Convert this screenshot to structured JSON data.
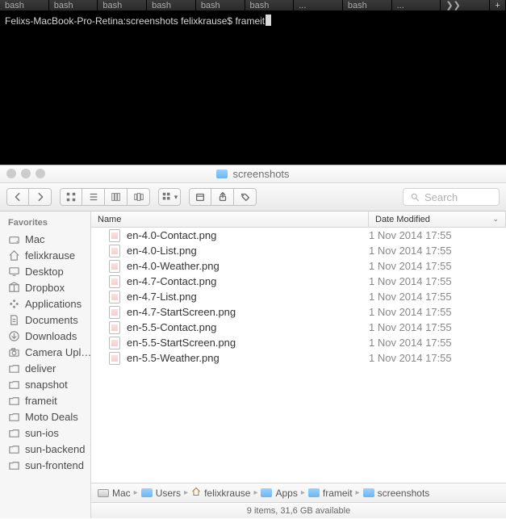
{
  "terminal": {
    "tabs": [
      "bash",
      "bash",
      "bash",
      "bash",
      "bash",
      "bash",
      "...",
      "bash",
      "...",
      "❯❯"
    ],
    "add": "+",
    "prompt": "Felixs-MacBook-Pro-Retina:screenshots felixkrause$ ",
    "command": "frameit"
  },
  "finder": {
    "window_title": "screenshots",
    "toolbar": {
      "search_placeholder": "Search"
    },
    "sidebar": {
      "heading": "Favorites",
      "items": [
        {
          "icon": "disk",
          "label": "Mac"
        },
        {
          "icon": "home",
          "label": "felixkrause"
        },
        {
          "icon": "desktop",
          "label": "Desktop"
        },
        {
          "icon": "box",
          "label": "Dropbox"
        },
        {
          "icon": "apps",
          "label": "Applications"
        },
        {
          "icon": "doc",
          "label": "Documents"
        },
        {
          "icon": "download",
          "label": "Downloads"
        },
        {
          "icon": "camera",
          "label": "Camera Upl…"
        },
        {
          "icon": "folder",
          "label": "deliver"
        },
        {
          "icon": "folder",
          "label": "snapshot"
        },
        {
          "icon": "folder",
          "label": "frameit"
        },
        {
          "icon": "folder",
          "label": "Moto Deals"
        },
        {
          "icon": "folder",
          "label": "sun-ios"
        },
        {
          "icon": "folder",
          "label": "sun-backend"
        },
        {
          "icon": "folder",
          "label": "sun-frontend"
        }
      ]
    },
    "columns": {
      "name": "Name",
      "date": "Date Modified"
    },
    "files": [
      {
        "name": "en-4.0-Contact.png",
        "date": "1 Nov 2014 17:55"
      },
      {
        "name": "en-4.0-List.png",
        "date": "1 Nov 2014 17:55"
      },
      {
        "name": "en-4.0-Weather.png",
        "date": "1 Nov 2014 17:55"
      },
      {
        "name": "en-4.7-Contact.png",
        "date": "1 Nov 2014 17:55"
      },
      {
        "name": "en-4.7-List.png",
        "date": "1 Nov 2014 17:55"
      },
      {
        "name": "en-4.7-StartScreen.png",
        "date": "1 Nov 2014 17:55"
      },
      {
        "name": "en-5.5-Contact.png",
        "date": "1 Nov 2014 17:55"
      },
      {
        "name": "en-5.5-StartScreen.png",
        "date": "1 Nov 2014 17:55"
      },
      {
        "name": "en-5.5-Weather.png",
        "date": "1 Nov 2014 17:55"
      }
    ],
    "path": [
      "Mac",
      "Users",
      "felixkrause",
      "Apps",
      "frameit",
      "screenshots"
    ],
    "status": "9 items, 31,6 GB available"
  }
}
